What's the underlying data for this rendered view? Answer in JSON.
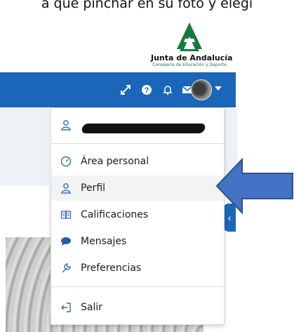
{
  "caption": "a que pinchar en su foto y elegi",
  "logo": {
    "line1": "Junta de Andalucía",
    "line2": "Consejería de Educación y Deporte",
    "accent": "#137b3c"
  },
  "navbar": {
    "color": "#1a66b8",
    "icons": [
      "expand-icon",
      "help-icon",
      "bell-icon",
      "mail-icon"
    ]
  },
  "menu": {
    "user": {
      "icon": "user-icon",
      "name_redacted": true
    },
    "items": [
      {
        "label": "Área personal",
        "icon": "dashboard-icon"
      },
      {
        "label": "Perfil",
        "icon": "user-icon",
        "highlighted": true
      },
      {
        "label": "Calificaciones",
        "icon": "book-icon"
      },
      {
        "label": "Mensajes",
        "icon": "chat-bubble-icon"
      },
      {
        "label": "Preferencias",
        "icon": "wrench-icon"
      }
    ],
    "logout": {
      "label": "Salir",
      "icon": "logout-icon"
    }
  },
  "callout": {
    "shape": "arrow-left",
    "color": "#4472c4"
  }
}
